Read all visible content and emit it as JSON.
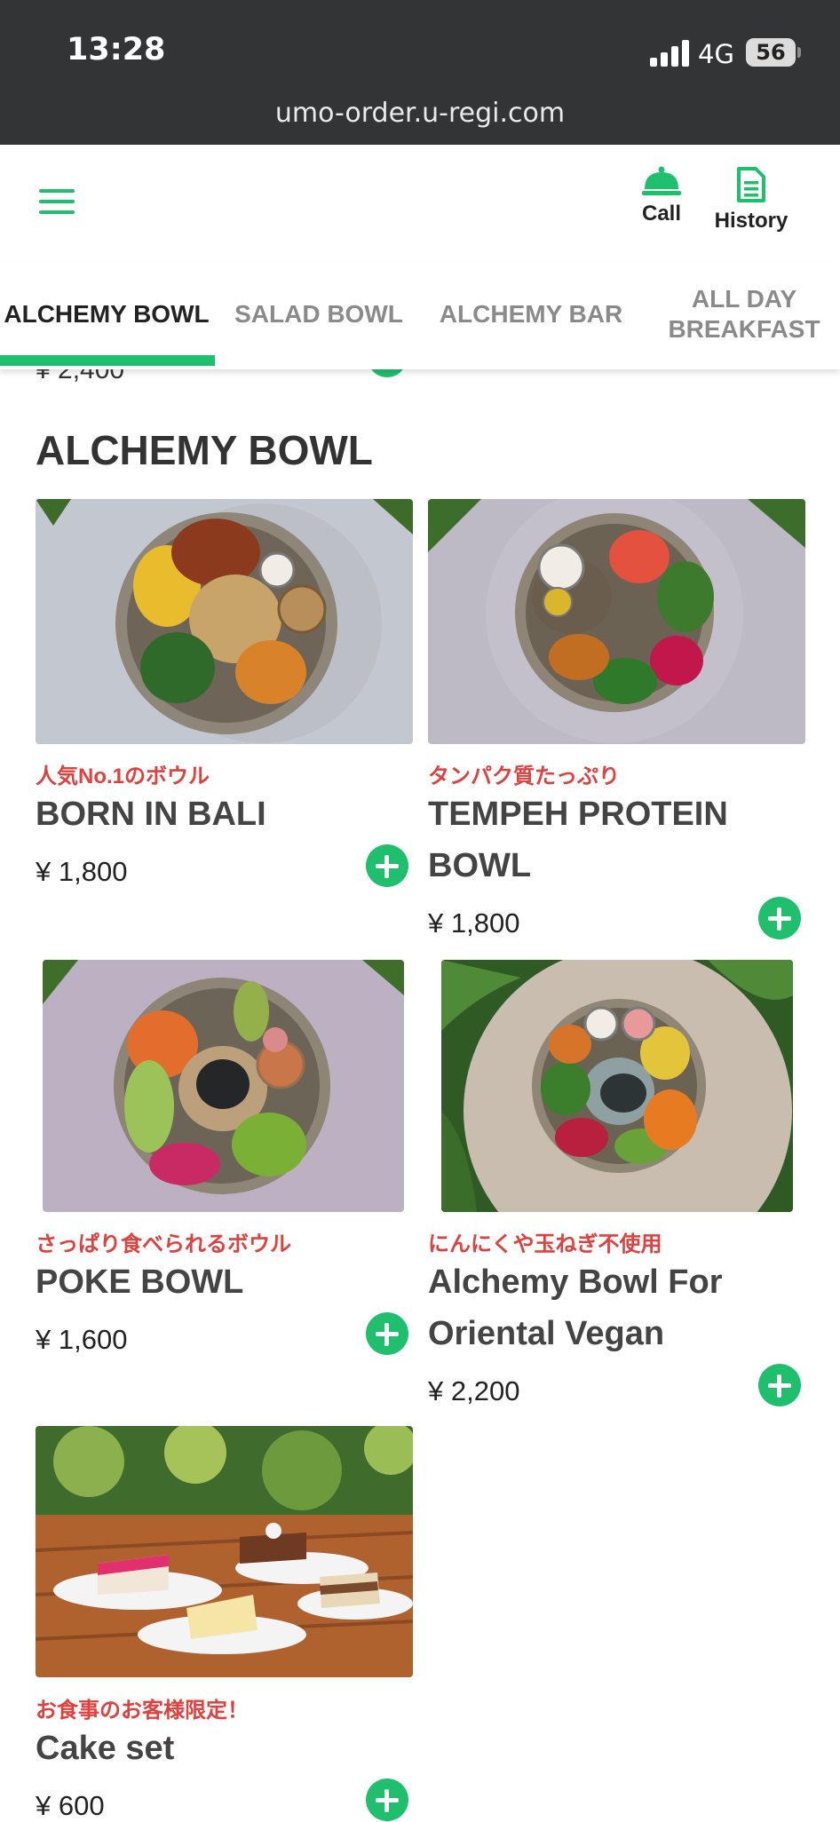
{
  "status_bar": {
    "time": "13:28",
    "network": "4G",
    "battery": "56"
  },
  "browser": {
    "url": "umo-order.u-regi.com"
  },
  "header": {
    "call_label": "Call",
    "history_label": "History"
  },
  "tabs": [
    {
      "label": "ALCHEMY BOWL",
      "active": true
    },
    {
      "label": "SALAD BOWL",
      "active": false
    },
    {
      "label": "ALCHEMY BAR",
      "active": false
    },
    {
      "label": "ALL DAY BREAKFAST",
      "active": false
    }
  ],
  "previous_section": {
    "price_peek": "¥ 2,400"
  },
  "section": {
    "title": "ALCHEMY BOWL",
    "items": [
      {
        "tag": "人気No.1のボウル",
        "name": "BORN IN BALI",
        "price": "¥ 1,800"
      },
      {
        "tag": "タンパク質たっぷり",
        "name": "TEMPEH PROTEIN BOWL",
        "price": "¥ 1,800"
      },
      {
        "tag": "さっぱり食べられるボウル",
        "name": "POKE BOWL",
        "price": "¥ 1,600"
      },
      {
        "tag": "にんにくや玉ねぎ不使用",
        "name": "Alchemy Bowl For Oriental Vegan",
        "price": "¥ 2,200"
      },
      {
        "tag": "お食事のお客様限定！",
        "name": "Cake set",
        "price": "¥ 600"
      }
    ]
  },
  "colors": {
    "accent": "#1fbf6e",
    "tag": "#e0413f",
    "statusbar": "#323436"
  }
}
